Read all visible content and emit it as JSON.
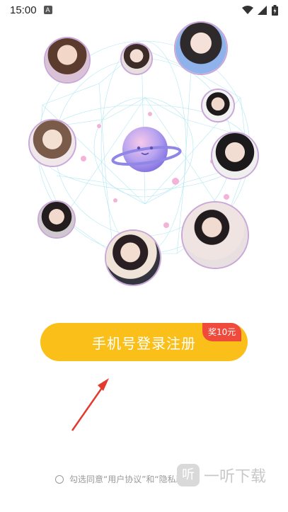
{
  "status_bar": {
    "time": "15:00",
    "notification_icon_label": "A",
    "icons": [
      "wifi-icon",
      "signal-icon",
      "battery-icon"
    ]
  },
  "hero": {
    "planet_colors": [
      "#f7c9ea",
      "#b9a4f0",
      "#7e6ee0"
    ],
    "network_color": "#9fe2ef",
    "avatars": [
      "avatar-1",
      "avatar-2",
      "avatar-3",
      "avatar-4",
      "avatar-5",
      "avatar-6",
      "avatar-7",
      "avatar-8",
      "avatar-9"
    ]
  },
  "login": {
    "button_label": "手机号登录注册",
    "reward_badge": "奖10元",
    "button_color": "#fbbf1a",
    "badge_color": "#ef4a3b"
  },
  "agreement": {
    "text": "勾选同意“用户协议”和“隐私政策”"
  },
  "watermark": {
    "logo_text": "听",
    "text": "一听下载"
  }
}
